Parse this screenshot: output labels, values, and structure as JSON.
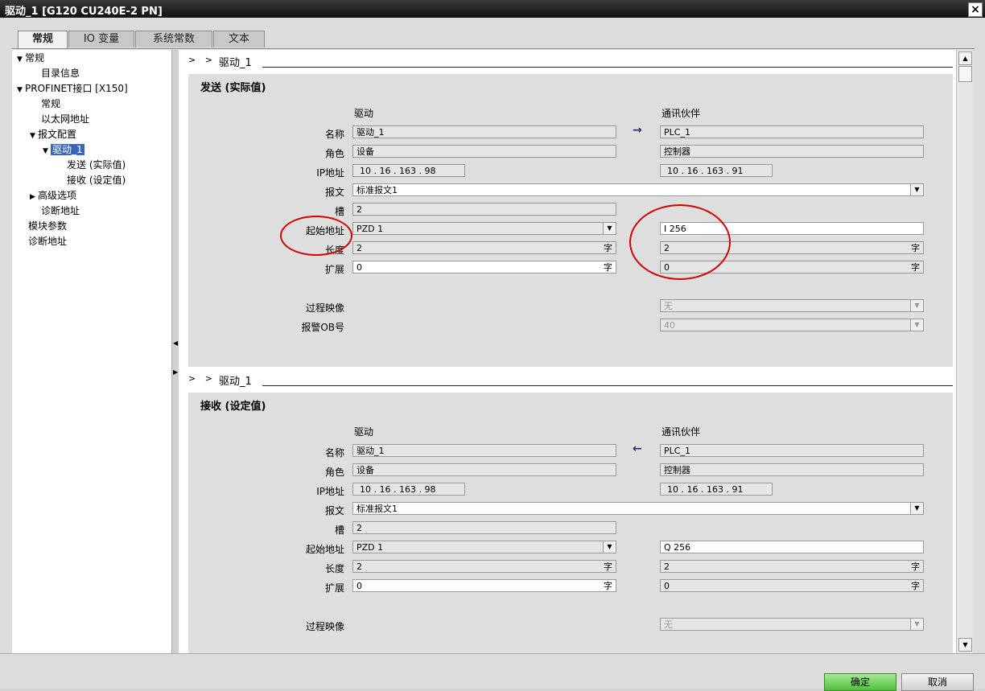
{
  "window": {
    "title": "驱动_1 [G120 CU240E-2 PN]",
    "close": "×"
  },
  "tabs": [
    "常规",
    "IO 变量",
    "系统常数",
    "文本"
  ],
  "tree": [
    {
      "label": "常规",
      "arrow": "▼"
    },
    {
      "label": "目录信息",
      "arrow": ""
    },
    {
      "label": "PROFINET接口 [X150]",
      "arrow": "▼"
    },
    {
      "label": "常规",
      "arrow": ""
    },
    {
      "label": "以太网地址",
      "arrow": ""
    },
    {
      "label": "报文配置",
      "arrow": "▼"
    },
    {
      "label": "驱动_1",
      "arrow": "▼"
    },
    {
      "label": "发送 (实际值)",
      "arrow": ""
    },
    {
      "label": "接收 (设定值)",
      "arrow": ""
    },
    {
      "label": "高级选项",
      "arrow": "▶"
    },
    {
      "label": "诊断地址",
      "arrow": ""
    },
    {
      "label": "模块参数",
      "arrow": ""
    },
    {
      "label": "诊断地址",
      "arrow": ""
    }
  ],
  "send": {
    "breadcrumb_chev": "> >",
    "breadcrumb": "驱动_1",
    "title": "发送 (实际值)",
    "col_drive": "驱动",
    "col_partner": "通讯伙伴",
    "labels": {
      "name": "名称",
      "role": "角色",
      "ip": "IP地址",
      "telegram": "报文",
      "slot": "槽",
      "start": "起始地址",
      "length": "长度",
      "ext": "扩展",
      "process_image": "过程映像",
      "alarm_ob": "报警OB号"
    },
    "drive": {
      "name": "驱动_1",
      "role": "设备",
      "ip": "10 . 16 . 163 . 98",
      "telegram": "标准报文1",
      "slot": "2",
      "start": "PZD 1",
      "length": "2",
      "ext": "0"
    },
    "partner": {
      "name": "PLC_1",
      "role": "控制器",
      "ip": "10 . 16 . 163 . 91",
      "start": "I 256",
      "length": "2",
      "ext": "0",
      "process_image": "无",
      "alarm_ob": "40"
    },
    "unit": "字",
    "arrow": "→"
  },
  "receive": {
    "breadcrumb_chev": "> >",
    "breadcrumb": "驱动_1",
    "title": "接收 (设定值)",
    "col_drive": "驱动",
    "col_partner": "通讯伙伴",
    "labels": {
      "name": "名称",
      "role": "角色",
      "ip": "IP地址",
      "telegram": "报文",
      "slot": "槽",
      "start": "起始地址",
      "length": "长度",
      "ext": "扩展",
      "process_image": "过程映像"
    },
    "drive": {
      "name": "驱动_1",
      "role": "设备",
      "ip": "10 . 16 . 163 . 98",
      "telegram": "标准报文1",
      "slot": "2",
      "start": "PZD 1",
      "length": "2",
      "ext": "0"
    },
    "partner": {
      "name": "PLC_1",
      "role": "控制器",
      "ip": "10 . 16 . 163 . 91",
      "start": "Q 256",
      "length": "2",
      "ext": "0",
      "process_image": "无"
    },
    "unit": "字",
    "arrow": "←"
  },
  "buttons": {
    "ok": "确定",
    "cancel": "取消"
  },
  "icons": {
    "scroll_up": "▲",
    "scroll_down": "▼",
    "dropdown": "▼",
    "splitter_left": "◀",
    "splitter_right": "▶"
  },
  "colors": {
    "annotation": "#d40000",
    "ok_green": "#4fbf3a",
    "selection": "#3a66b8"
  }
}
